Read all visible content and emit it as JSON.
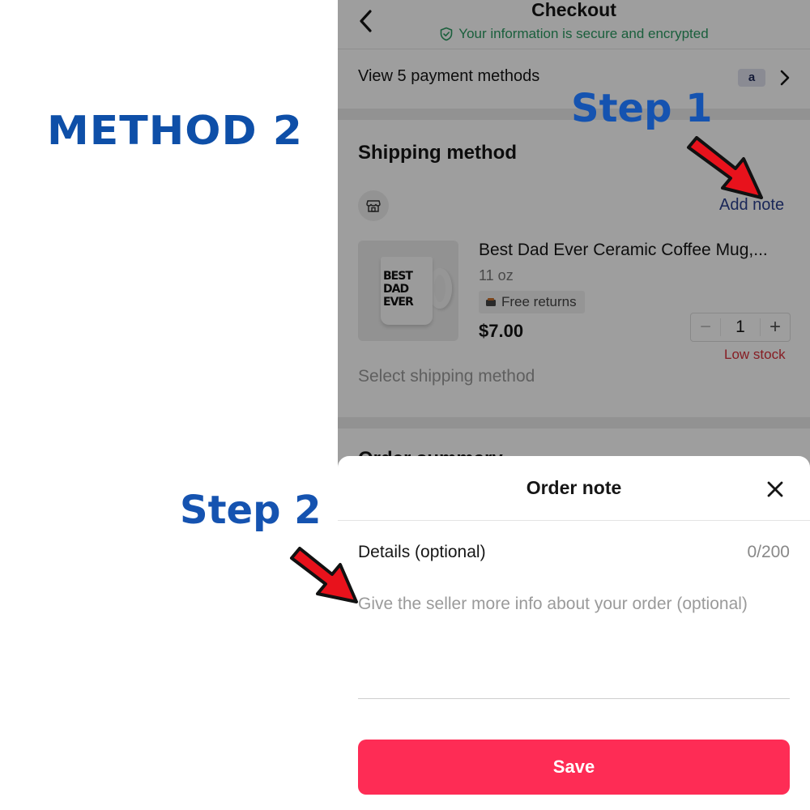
{
  "annotations": {
    "method_title": "METHOD 2",
    "step1": "Step 1",
    "step2": "Step 2",
    "arrow_color": "#e8121c"
  },
  "header": {
    "title": "Checkout",
    "secure_text": "Your information is secure and encrypted",
    "back_icon": "chevron-left-icon",
    "secure_icon": "shield-check-icon",
    "secure_color": "#2a9a62"
  },
  "payment": {
    "label": "View 5 payment methods",
    "badge": "a",
    "chevron_icon": "chevron-right-icon"
  },
  "shipping": {
    "title": "Shipping method",
    "store_icon": "store-icon",
    "add_note": "Add note",
    "product": {
      "title": "Best Dad Ever Ceramic Coffee Mug,...",
      "size": "11 oz",
      "returns_badge": "Free returns",
      "price": "$7.00",
      "quantity": "1",
      "qty_minus": "−",
      "qty_plus": "+",
      "stock_status": "Low stock",
      "mug_text": "BEST DAD EVER"
    },
    "select_shipping": "Select shipping method"
  },
  "order_summary": {
    "title": "Order summary"
  },
  "sheet": {
    "title": "Order note",
    "details_label": "Details (optional)",
    "char_count": "0/200",
    "note_value": "",
    "note_placeholder": "Give the seller more info about your order (optional)",
    "save_label": "Save",
    "save_color": "#fe2c55"
  }
}
